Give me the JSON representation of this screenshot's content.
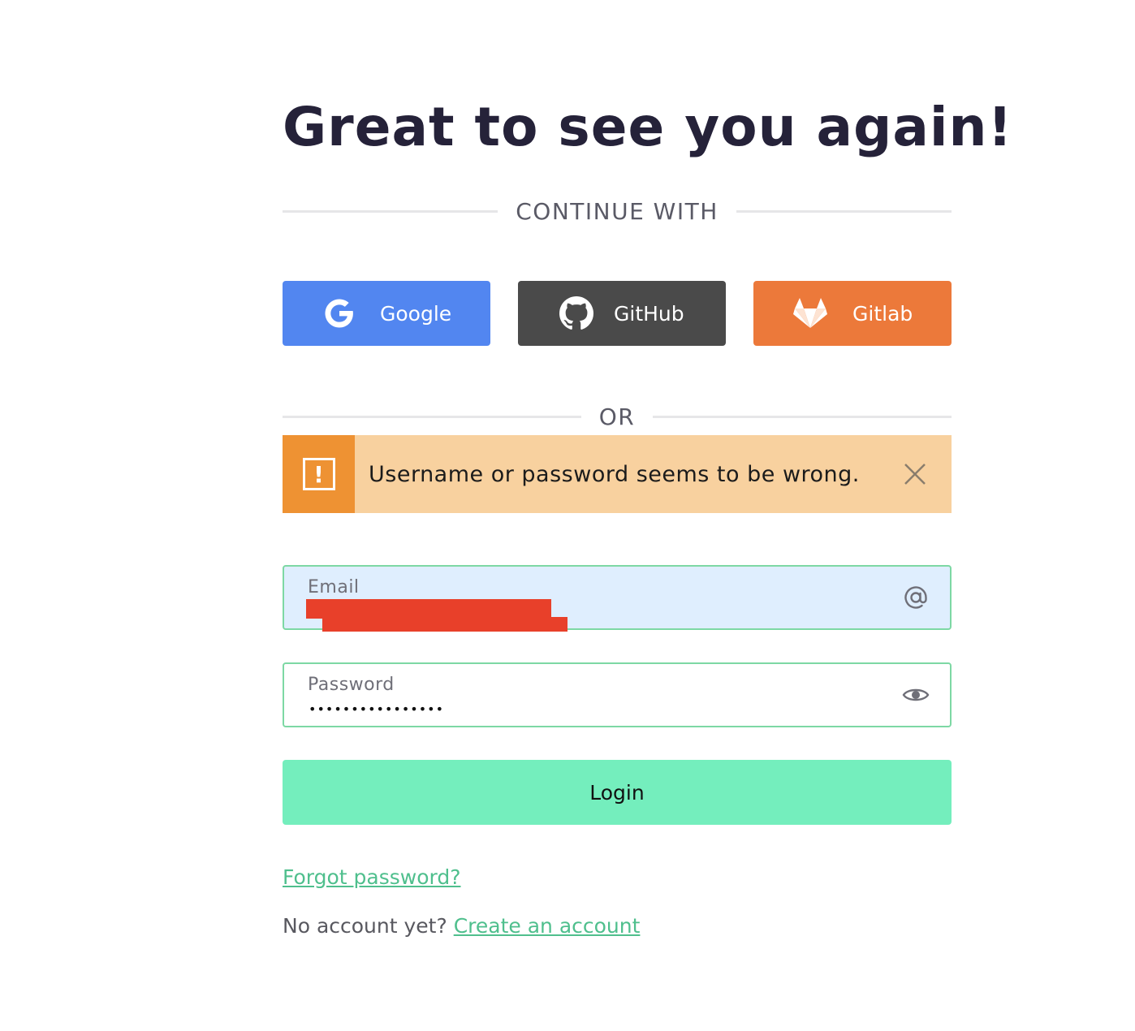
{
  "page": {
    "title": "Great to see you again!"
  },
  "dividers": {
    "continue_with": "CONTINUE WITH",
    "or": "OR"
  },
  "social": {
    "google": {
      "label": "Google",
      "icon": "google-icon",
      "color": "#5286f0"
    },
    "github": {
      "label": "GitHub",
      "icon": "github-icon",
      "color": "#4a4a4a"
    },
    "gitlab": {
      "label": "Gitlab",
      "icon": "gitlab-icon",
      "color": "#ec793a"
    }
  },
  "alert": {
    "message": "Username or password seems to be wrong.",
    "icon": "warning-icon",
    "close_icon": "close-icon",
    "bg_color": "#f8d19f",
    "icon_bg_color": "#ee9233"
  },
  "email_field": {
    "label": "Email",
    "value": "",
    "icon": "at-sign-icon"
  },
  "password_field": {
    "label": "Password",
    "masked_value": "••••••••••••••••",
    "icon": "eye-icon"
  },
  "login": {
    "label": "Login",
    "color": "#74eebd"
  },
  "links": {
    "forgot_password": "Forgot password?",
    "no_account_text": "No account yet?",
    "create_account": "Create an account",
    "link_color": "#4fbf8d"
  }
}
